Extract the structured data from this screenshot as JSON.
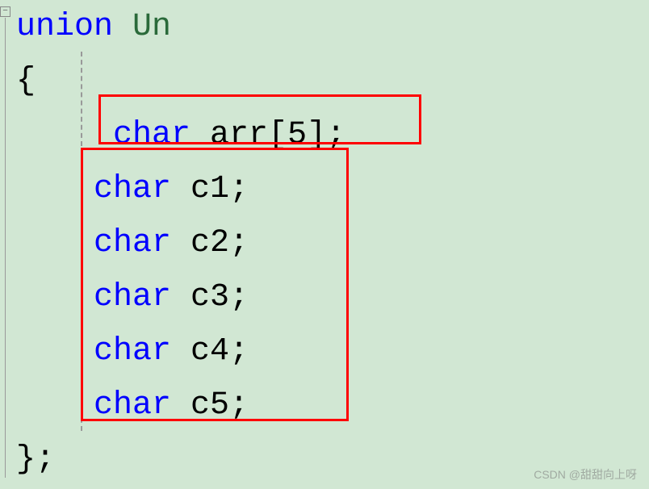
{
  "code": {
    "line1_keyword": "union",
    "line1_name": "Un",
    "line2": "{",
    "line3_type": "char",
    "line3_rest": " arr[5];",
    "line4_type": "char",
    "line4_rest": " c1;",
    "line5_type": "char",
    "line5_rest": " c2;",
    "line6_type": "char",
    "line6_rest": " c3;",
    "line7_type": "char",
    "line7_rest": " c4;",
    "line8_type": "char",
    "line8_rest": " c5;",
    "line9": "};"
  },
  "fold_symbol": "−",
  "watermark": "CSDN @甜甜向上呀"
}
